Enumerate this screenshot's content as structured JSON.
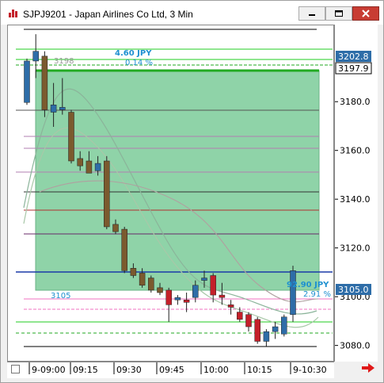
{
  "window": {
    "title": "SJPJ9201 - Japan Airlines Co Ltd, 3 Min"
  },
  "price_axis": {
    "ticks": [
      "3180.0",
      "3160.0",
      "3140.0",
      "3120.0",
      "3100.0",
      "3080.0"
    ],
    "badges": [
      {
        "label": "3202.8",
        "color": "#2e6da8"
      },
      {
        "label": "3197.9",
        "color": "#ffffff"
      },
      {
        "label": "3105.0",
        "color": "#2e6da8"
      }
    ]
  },
  "time_axis": {
    "ticks": [
      "9-09:00",
      "09:15",
      "09:30",
      "09:45",
      "10:00",
      "10:15",
      "9-10:30"
    ]
  },
  "annotations": {
    "top_diff": "4.60  JPY",
    "top_pct": "0.14 %",
    "ghost_price": "3198",
    "bottom_diff": "92.90  JPY",
    "bottom_pct": "2.91 %",
    "range_low": "3105"
  },
  "chart_data": {
    "type": "candlestick",
    "ylim": [
      3075,
      3210
    ],
    "candles": [
      {
        "o": 3180,
        "h": 3198,
        "l": 3179,
        "c": 3197
      },
      {
        "o": 3197,
        "h": 3208,
        "l": 3190,
        "c": 3201
      },
      {
        "o": 3199,
        "h": 3201,
        "l": 3174,
        "c": 3177
      },
      {
        "o": 3176,
        "h": 3188,
        "l": 3170,
        "c": 3179
      },
      {
        "o": 3177,
        "h": 3190,
        "l": 3175,
        "c": 3178
      },
      {
        "o": 3176,
        "h": 3177,
        "l": 3155,
        "c": 3156
      },
      {
        "o": 3157,
        "h": 3160,
        "l": 3152,
        "c": 3154
      },
      {
        "o": 3156,
        "h": 3160,
        "l": 3152,
        "c": 3151
      },
      {
        "o": 3152,
        "h": 3158,
        "l": 3150,
        "c": 3155
      },
      {
        "o": 3156,
        "h": 3158,
        "l": 3128,
        "c": 3129
      },
      {
        "o": 3130,
        "h": 3132,
        "l": 3126,
        "c": 3127
      },
      {
        "o": 3128,
        "h": 3129,
        "l": 3110,
        "c": 3111
      },
      {
        "o": 3112,
        "h": 3114,
        "l": 3108,
        "c": 3109
      },
      {
        "o": 3110,
        "h": 3112,
        "l": 3104,
        "c": 3105
      },
      {
        "o": 3108,
        "h": 3109,
        "l": 3102,
        "c": 3103
      },
      {
        "o": 3104,
        "h": 3106,
        "l": 3101,
        "c": 3102
      },
      {
        "o": 3103,
        "h": 3104,
        "l": 3090,
        "c": 3097
      },
      {
        "o": 3099,
        "h": 3101,
        "l": 3097,
        "c": 3100
      },
      {
        "o": 3099,
        "h": 3102,
        "l": 3094,
        "c": 3098
      },
      {
        "o": 3100,
        "h": 3107,
        "l": 3098,
        "c": 3105
      },
      {
        "o": 3107,
        "h": 3111,
        "l": 3104,
        "c": 3108
      },
      {
        "o": 3109,
        "h": 3110,
        "l": 3098,
        "c": 3101
      },
      {
        "o": 3101,
        "h": 3106,
        "l": 3097,
        "c": 3100
      },
      {
        "o": 3097,
        "h": 3099,
        "l": 3093,
        "c": 3096
      },
      {
        "o": 3094,
        "h": 3096,
        "l": 3090,
        "c": 3091
      },
      {
        "o": 3093,
        "h": 3094,
        "l": 3086,
        "c": 3088
      },
      {
        "o": 3091,
        "h": 3092,
        "l": 3081,
        "c": 3082
      },
      {
        "o": 3082,
        "h": 3087,
        "l": 3080,
        "c": 3086
      },
      {
        "o": 3086,
        "h": 3090,
        "l": 3083,
        "c": 3088
      },
      {
        "o": 3085,
        "h": 3093,
        "l": 3084,
        "c": 3092
      },
      {
        "o": 3093,
        "h": 3113,
        "l": 3090,
        "c": 3111
      }
    ]
  },
  "colors": {
    "up": "#2e6da8",
    "down": "#7b5a2e",
    "down_red": "#c4202a",
    "zone": "#8fd3a8"
  }
}
